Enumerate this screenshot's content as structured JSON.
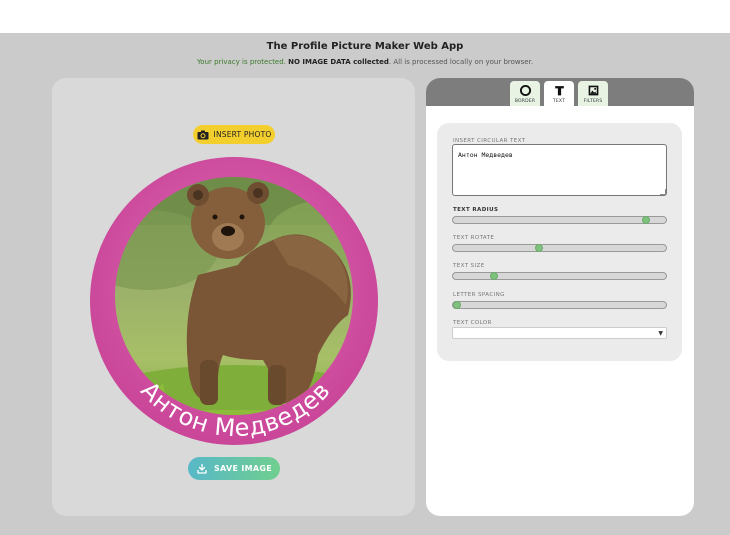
{
  "header": {
    "title": "The Profile Picture Maker Web App",
    "subtitle_part1": "Your privacy is protected.",
    "subtitle_bold": "NO IMAGE DATA collected",
    "subtitle_part2": ". All is processed locally on your browser."
  },
  "left": {
    "insert_photo_label": "INSERT PHOTO",
    "circular_text": "Антон Медведев",
    "save_label": "SAVE IMAGE",
    "ring_color": "#d657a8"
  },
  "tabs": [
    {
      "label": "BORDER",
      "icon": "circle-icon",
      "active": false
    },
    {
      "label": "TEXT",
      "icon": "text-t-icon",
      "active": true
    },
    {
      "label": "FILTERS",
      "icon": "filter-image-icon",
      "active": false
    }
  ],
  "form": {
    "circular_text_label": "INSERT CIRCULAR TEXT",
    "circular_text_value": "Антон Медведев",
    "radius_label": "TEXT RADIUS",
    "radius_value": 0.92,
    "rotate_label": "TEXT ROTATE",
    "rotate_value": 0.4,
    "size_label": "TEXT SIZE",
    "size_value": 0.18,
    "spacing_label": "LETTER SPACING",
    "spacing_value": 0.0,
    "color_label": "TEXT COLOR",
    "color_value": ""
  }
}
